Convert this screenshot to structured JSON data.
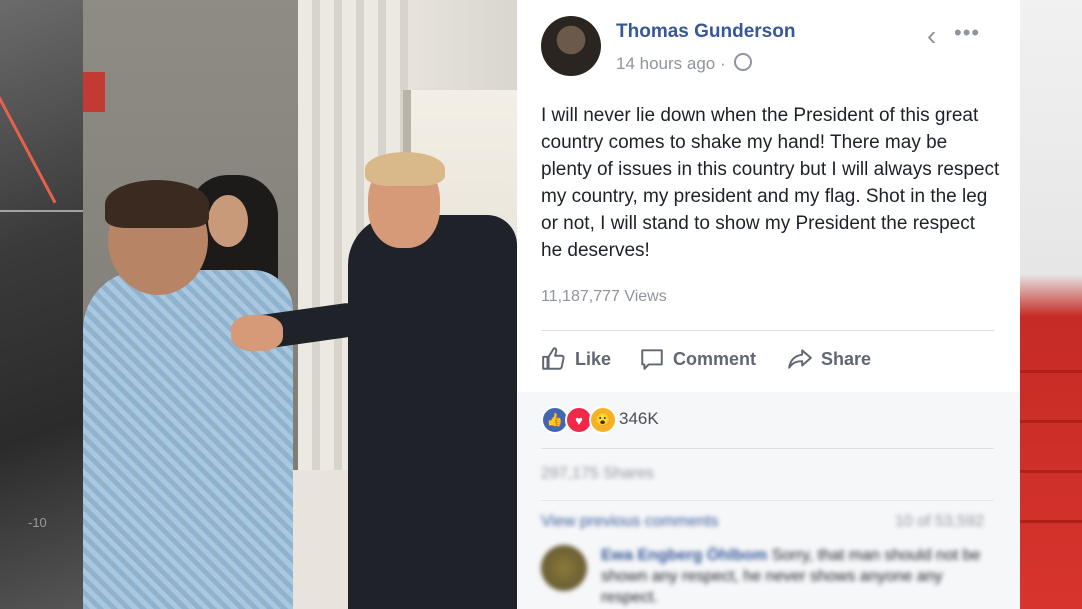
{
  "background_left": {
    "number": "-10"
  },
  "post": {
    "author": "Thomas Gunderson",
    "timestamp": "14 hours ago",
    "body": "I will never lie down when the President of this great country comes to shake my hand! There may be plenty of issues in this country but I will always respect my country, my president and my flag. Shot in the leg or not, I will stand to show my President the respect he deserves!",
    "views": "11,187,777 Views",
    "actions": {
      "like": "Like",
      "comment": "Comment",
      "share": "Share"
    },
    "reactions": {
      "count": "346K",
      "icons": [
        "like-icon",
        "love-icon",
        "wow-icon"
      ],
      "colors": {
        "like": "#4267b2",
        "love": "#f0284a",
        "wow": "#f7b125"
      }
    },
    "shares": "297,175 Shares",
    "view_previous_comments": "View previous comments",
    "comment_pager": "10 of 53,592",
    "comment": {
      "author": "Ewa Engberg Öhlbom",
      "text": "Sorry, that man should not be shown any respect, he never shows anyone any respect."
    }
  },
  "colors": {
    "link": "#365899",
    "muted": "#90949c",
    "text": "#1d2129"
  }
}
